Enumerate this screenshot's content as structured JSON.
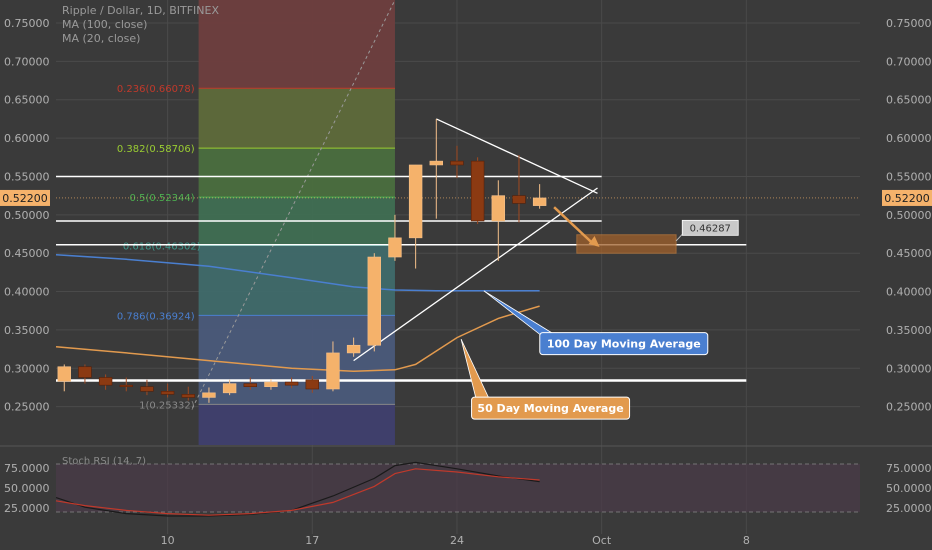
{
  "header": {
    "symbol_line": "Ripple / Dollar, 1D, BITFINEX",
    "study_line_1": "MA (100, close)",
    "study_line_2": "MA (20, close)"
  },
  "colors": {
    "background": "#3a3a3a",
    "grid": "#4a4a4a",
    "bull_candle": "#f5b26b",
    "bear_candle": "#8b3a12",
    "ma100": "#4a7fd0",
    "ma50": "#e29a4e",
    "price_tag": "#f5b26b",
    "white_line": "#ffffff"
  },
  "chart_data": {
    "type": "candlestick",
    "y_range": [
      0.2,
      0.78
    ],
    "y_ticks": [
      "0.75000",
      "0.70000",
      "0.65000",
      "0.60000",
      "0.55000",
      "0.50000",
      "0.45000",
      "0.40000",
      "0.35000",
      "0.30000",
      "0.25000"
    ],
    "x_ticks": [
      {
        "day": 10,
        "label": "10"
      },
      {
        "day": 17,
        "label": "17"
      },
      {
        "day": 24,
        "label": "24"
      },
      {
        "day": 31,
        "label": "Oct"
      },
      {
        "day": 38,
        "label": "8"
      }
    ],
    "x_range": [
      4.6,
      43.5
    ],
    "current_price": {
      "value": 0.522,
      "label": "0.52200"
    },
    "candles": [
      {
        "day": 5,
        "o": 0.283,
        "h": 0.305,
        "l": 0.27,
        "c": 0.302
      },
      {
        "day": 6,
        "o": 0.302,
        "h": 0.305,
        "l": 0.28,
        "c": 0.288
      },
      {
        "day": 7,
        "o": 0.288,
        "h": 0.292,
        "l": 0.272,
        "c": 0.278
      },
      {
        "day": 8,
        "o": 0.278,
        "h": 0.288,
        "l": 0.27,
        "c": 0.276
      },
      {
        "day": 9,
        "o": 0.276,
        "h": 0.285,
        "l": 0.265,
        "c": 0.27
      },
      {
        "day": 10,
        "o": 0.27,
        "h": 0.28,
        "l": 0.262,
        "c": 0.266
      },
      {
        "day": 11,
        "o": 0.266,
        "h": 0.276,
        "l": 0.258,
        "c": 0.262
      },
      {
        "day": 12,
        "o": 0.262,
        "h": 0.275,
        "l": 0.255,
        "c": 0.268
      },
      {
        "day": 13,
        "o": 0.268,
        "h": 0.285,
        "l": 0.265,
        "c": 0.28
      },
      {
        "day": 14,
        "o": 0.28,
        "h": 0.288,
        "l": 0.272,
        "c": 0.276
      },
      {
        "day": 15,
        "o": 0.276,
        "h": 0.286,
        "l": 0.272,
        "c": 0.282
      },
      {
        "day": 16,
        "o": 0.282,
        "h": 0.288,
        "l": 0.274,
        "c": 0.278
      },
      {
        "day": 17,
        "o": 0.285,
        "h": 0.29,
        "l": 0.268,
        "c": 0.273
      },
      {
        "day": 18,
        "o": 0.273,
        "h": 0.335,
        "l": 0.27,
        "c": 0.32
      },
      {
        "day": 19,
        "o": 0.32,
        "h": 0.34,
        "l": 0.315,
        "c": 0.33
      },
      {
        "day": 20,
        "o": 0.33,
        "h": 0.45,
        "l": 0.322,
        "c": 0.445
      },
      {
        "day": 21,
        "o": 0.445,
        "h": 0.5,
        "l": 0.44,
        "c": 0.47
      },
      {
        "day": 22,
        "o": 0.47,
        "h": 0.565,
        "l": 0.43,
        "c": 0.565
      },
      {
        "day": 23,
        "o": 0.565,
        "h": 0.625,
        "l": 0.495,
        "c": 0.57
      },
      {
        "day": 24,
        "o": 0.57,
        "h": 0.59,
        "l": 0.548,
        "c": 0.565
      },
      {
        "day": 25,
        "o": 0.57,
        "h": 0.575,
        "l": 0.488,
        "c": 0.492
      },
      {
        "day": 26,
        "o": 0.492,
        "h": 0.545,
        "l": 0.44,
        "c": 0.525
      },
      {
        "day": 27,
        "o": 0.525,
        "h": 0.578,
        "l": 0.49,
        "c": 0.515
      },
      {
        "day": 28,
        "o": 0.512,
        "h": 0.54,
        "l": 0.508,
        "c": 0.522
      }
    ],
    "ma100": [
      [
        4.6,
        0.448
      ],
      [
        8,
        0.442
      ],
      [
        12,
        0.433
      ],
      [
        16,
        0.418
      ],
      [
        19,
        0.406
      ],
      [
        21,
        0.402
      ],
      [
        23,
        0.401
      ],
      [
        25,
        0.401
      ],
      [
        28,
        0.401
      ]
    ],
    "ma50": [
      [
        4.6,
        0.328
      ],
      [
        8,
        0.32
      ],
      [
        12,
        0.31
      ],
      [
        16,
        0.3
      ],
      [
        19,
        0.296
      ],
      [
        21,
        0.298
      ],
      [
        22,
        0.305
      ],
      [
        24,
        0.34
      ],
      [
        26,
        0.365
      ],
      [
        28,
        0.381
      ]
    ],
    "horizontal_lines": [
      0.55,
      0.492,
      0.461,
      0.284
    ],
    "triangle": [
      {
        "x1": 23,
        "y1": 0.625,
        "x2": 30.8,
        "y2": 0.528
      },
      {
        "x1": 19,
        "y1": 0.31,
        "x2": 30.8,
        "y2": 0.535
      }
    ],
    "fibonacci": {
      "x_start": 11.5,
      "x_end": 21,
      "levels": [
        {
          "value": 0.253,
          "label": "1(0.25332)"
        },
        {
          "value": 0.369,
          "label": "0.786(0.36924)"
        },
        {
          "value": 0.46,
          "label": "0.618(0.46302)"
        },
        {
          "value": 0.523,
          "label": "0.5(0.52344)"
        },
        {
          "value": 0.587,
          "label": "0.382(0.58706)"
        },
        {
          "value": 0.665,
          "label": "0.236(0.66078)"
        }
      ]
    },
    "target_box": {
      "x1": 29.8,
      "x2": 34.6,
      "y_low": 0.45,
      "y_high": 0.474
    },
    "target_label": "0.46287",
    "annotations": [
      {
        "text": "100 Day Moving Average",
        "color": "#4a7fd0"
      },
      {
        "text": "50 Day Moving Average",
        "color": "#e29a4e"
      }
    ],
    "rsi": {
      "ticks": [
        "75.0000",
        "50.0000",
        "25.0000"
      ],
      "legend": "Stoch RSI (14, 7)",
      "k": [
        [
          4.6,
          38
        ],
        [
          6,
          26
        ],
        [
          8,
          18
        ],
        [
          10,
          15
        ],
        [
          12,
          15
        ],
        [
          14,
          17
        ],
        [
          16,
          22
        ],
        [
          18,
          40
        ],
        [
          20,
          62
        ],
        [
          21,
          78
        ],
        [
          22,
          82
        ],
        [
          24,
          74
        ],
        [
          26,
          65
        ],
        [
          28,
          58
        ]
      ],
      "d": [
        [
          4.6,
          34
        ],
        [
          6,
          28
        ],
        [
          8,
          22
        ],
        [
          10,
          18
        ],
        [
          12,
          16
        ],
        [
          14,
          18
        ],
        [
          16,
          22
        ],
        [
          18,
          32
        ],
        [
          20,
          52
        ],
        [
          21,
          68
        ],
        [
          22,
          74
        ],
        [
          24,
          70
        ],
        [
          26,
          64
        ],
        [
          28,
          60
        ]
      ]
    }
  }
}
